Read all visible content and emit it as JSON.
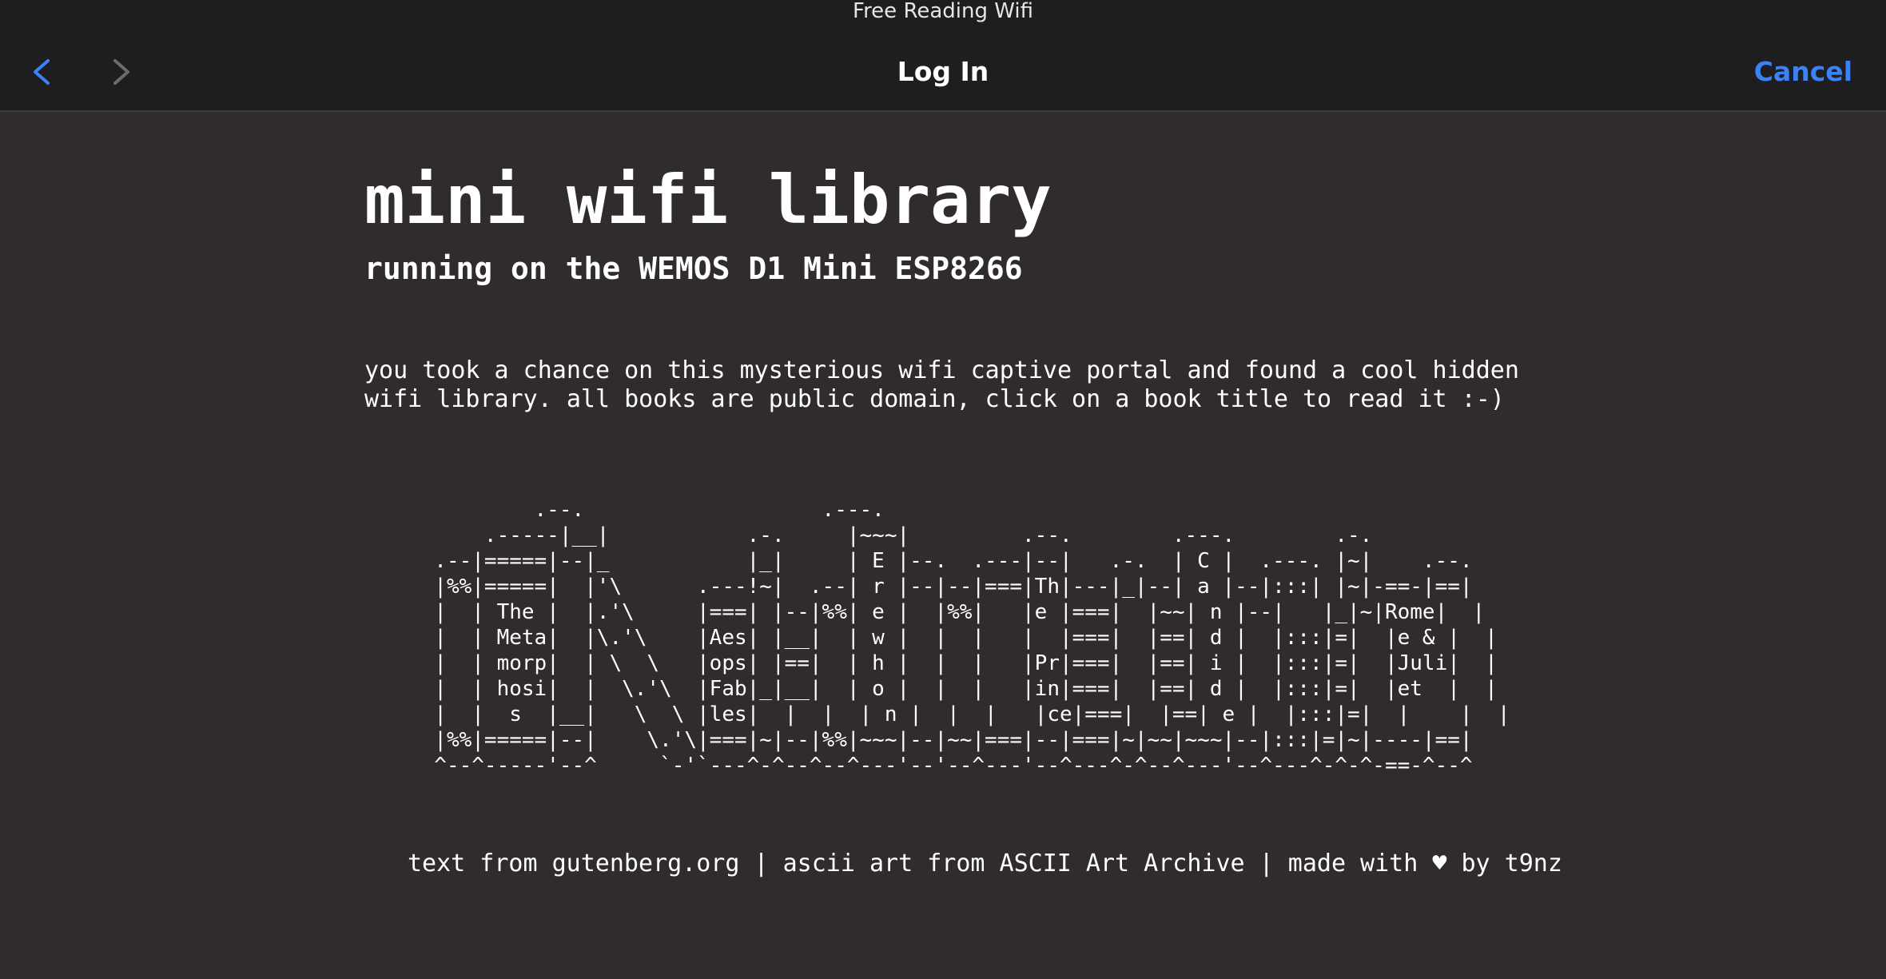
{
  "window": {
    "system_title": "Free Reading Wifi"
  },
  "navbar": {
    "title": "Log In",
    "back_icon": "chevron-left-icon",
    "forward_icon": "chevron-right-icon",
    "cancel_label": "Cancel",
    "accent_color": "#3b82f6",
    "disabled_color": "#6b6b6e"
  },
  "page": {
    "heading": "mini wifi library",
    "subheading": "running on the WEMOS D1 Mini ESP8266",
    "intro_lines": [
      "you took a chance on this mysterious wifi captive portal and found a cool hidden",
      "wifi library. all books are public domain, click on a book title to read it :-)"
    ],
    "bookshelf_ascii": "          .--.                   .---.\n      .-----|__|           .-.     |~~~|         .--.        .---.        .-.\n  .--|=====|--|_           |_|     | E |--.  .---|--|   .-.  | C |  .---. |~|    .--.\n  |%%|=====|  |'\\      .---!~|  .--| r |--|--|===|Th|---|_|--| a |--|:::| |~|-==-|==|\n  |  | The |  |.'\\     |===| |--|%%| e |  |%%|   |e |===|  |~~| n |--|   |_|~|Rome|  |\n  |  | Meta|  |\\.'\\    |Aes| |__|  | w |  |  |   |  |===|  |==| d |  |:::|=|  |e & |  |\n  |  | morp|  | \\  \\   |ops| |==|  | h |  |  |   |Pr|===|  |==| i |  |:::|=|  |Juli|  |\n  |  | hosi|  |  \\.'\\  |Fab|_|__|  | o |  |  |   |in|===|  |==| d |  |:::|=|  |et  |  |\n  |  |  s  |__|   \\  \\ |les|  |  |  | n |  |  |   |ce|===|  |==| e |  |:::|=|  |    |  |\n  |%%|=====|--|    \\.'\\|===|~|--|%%|~~~|--|~~|===|--|===|~|~~|~~~|--|:::|=|~|----|==|\n  ^--^-----'--^     `-'`---^-^--^--^---'--'--^---'--^---^-^--^---'--^---^-^-^-==-^--^",
    "footer": "text from gutenberg.org | ascii art from ASCII Art Archive | made with ♥ by t9nz"
  },
  "colors": {
    "page_background": "#2f2c2b",
    "navbar_background": "#1e1e20",
    "text": "#ffffff"
  }
}
